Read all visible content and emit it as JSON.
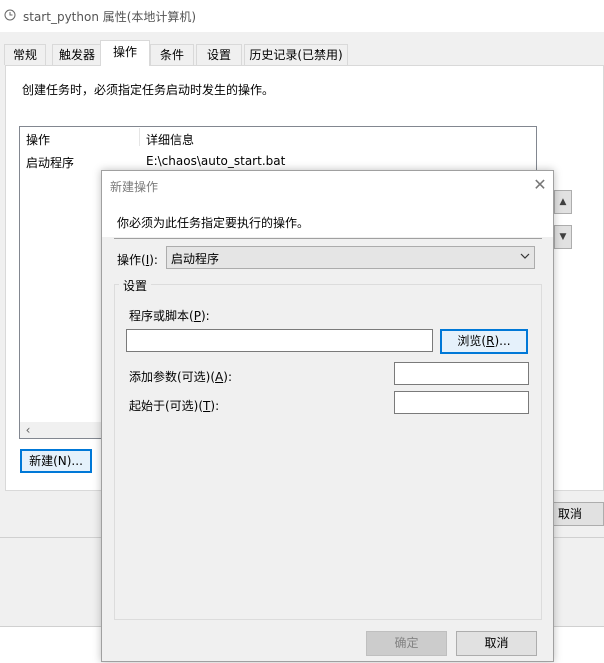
{
  "window": {
    "title": "start_python 属性(本地计算机)",
    "tabs": [
      "常规",
      "触发器",
      "操作",
      "条件",
      "设置",
      "历史记录(已禁用)"
    ],
    "active_tab": "操作",
    "description": "创建任务时，必须指定任务启动时发生的操作。",
    "list": {
      "headers": [
        "操作",
        "详细信息"
      ],
      "rows": [
        {
          "action": "启动程序",
          "details": "E:\\chaos\\auto_start.bat"
        }
      ]
    },
    "new_button": "新建(N)...",
    "cancel_button": "取消"
  },
  "dialog": {
    "title": "新建操作",
    "description": "你必须为此任务指定要执行的操作。",
    "action_label": "操作(I):",
    "action_value": "启动程序",
    "settings_group": "设置",
    "program_label": "程序或脚本(P):",
    "program_value": "",
    "browse_button": "浏览(R)...",
    "args_label": "添加参数(可选)(A):",
    "args_value": "",
    "start_in_label": "起始于(可选)(T):",
    "start_in_value": "",
    "ok_button": "确定",
    "cancel_button": "取消"
  },
  "colors": {
    "accent": "#0078d7",
    "disabled_text": "#838383",
    "panel_bg": "#f0f0f0"
  }
}
